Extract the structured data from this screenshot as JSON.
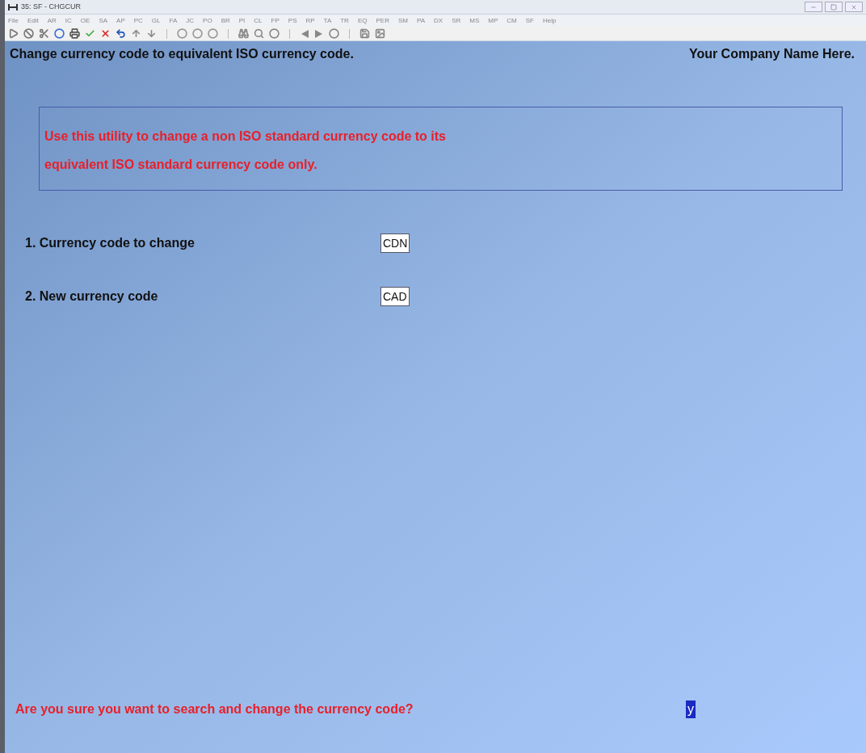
{
  "window": {
    "title": "35: SF - CHGCUR"
  },
  "menu": [
    "File",
    "Edit",
    "AR",
    "IC",
    "OE",
    "SA",
    "AP",
    "PC",
    "GL",
    "FA",
    "JC",
    "PO",
    "BR",
    "PI",
    "CL",
    "FP",
    "PS",
    "RP",
    "TA",
    "TR",
    "EQ",
    "PER",
    "SM",
    "PA",
    "DX",
    "SR",
    "MS",
    "MP",
    "CM",
    "SF",
    "Help"
  ],
  "header": {
    "title": "Change currency code to equivalent ISO currency code.",
    "company": "Your Company Name Here."
  },
  "notice": [
    "Use this utility to change a non ISO standard currency code to its",
    "equivalent ISO standard currency code only."
  ],
  "fields": [
    {
      "label": "1. Currency code to change",
      "value": "CDN"
    },
    {
      "label": "2. New currency code",
      "value": "CAD"
    }
  ],
  "prompt": {
    "question": "Are you sure you want to search and change the currency code?",
    "answer": "y"
  }
}
